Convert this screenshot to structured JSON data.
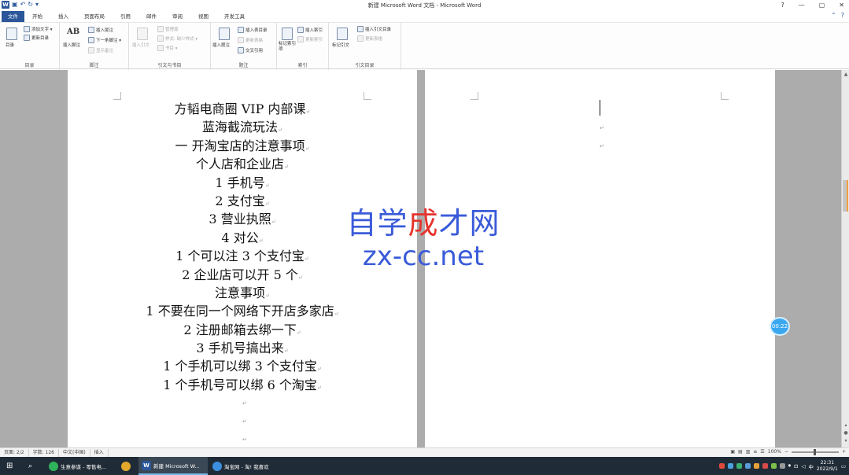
{
  "titlebar": {
    "title": "新建 Microsoft Word 文档 - Microsoft Word",
    "word_logo": "W",
    "controls": [
      "?",
      "—",
      "▢",
      "✕"
    ]
  },
  "tabs": [
    "文件",
    "开始",
    "插入",
    "页面布局",
    "引用",
    "邮件",
    "审阅",
    "视图",
    "开发工具"
  ],
  "ribbon": {
    "toc": {
      "big": "目录",
      "add_text": "添加文字 ▾",
      "update": "更新目录",
      "label": "目录"
    },
    "footnote": {
      "insert_footnote": "插入脚注",
      "insert_endnote": "插入尾注",
      "next_footnote": "下一条脚注 ▾",
      "show_notes": "显示备注",
      "label": "脚注",
      "ab_glyph": "AB"
    },
    "citation": {
      "insert_citation": "插入引文",
      "manage_sources": "管理源",
      "style": "样式: 缺少样式 ▾",
      "bibliography": "书目 ▾",
      "label": "引文与书目"
    },
    "caption": {
      "insert_caption": "插入题注",
      "insert_table_figures": "插入表目录",
      "update_table": "更新表格",
      "cross_ref": "交叉引用",
      "label": "题注"
    },
    "index": {
      "mark_entry": "标记索引项",
      "insert_index": "插入索引",
      "update_index": "更新索引",
      "label": "索引"
    },
    "authorities": {
      "mark_citation": "标记引文",
      "insert_toa": "插入引文目录",
      "update_table": "更新表格",
      "label": "引文目录"
    }
  },
  "document": {
    "lines": [
      "方韬电商圈 VIP 内部课",
      "蓝海截流玩法",
      "一  开淘宝店的注意事项",
      "个人店和企业店",
      "1 手机号",
      "2 支付宝",
      "3 营业执照",
      "4 对公",
      "1 个可以注 3 个支付宝",
      "2 企业店可以开 5 个",
      "注意事项",
      "1 不要在同一个网络下开店多家店",
      "2 注册邮箱去绑一下",
      "3 手机号搞出来",
      "1 个手机可以绑 3 个支付宝",
      "1 个手机号可以绑 6 个淘宝"
    ],
    "para_mark": "↵"
  },
  "watermark": {
    "cn": "自学成才网",
    "en": "zx-cc.net"
  },
  "timer": "00:22",
  "statusbar": {
    "page": "页面: 2/2",
    "words": "字数: 126",
    "lang": "中文(中国)",
    "mode": "插入",
    "zoom": "100%"
  },
  "taskbar": {
    "items": [
      {
        "label": "生意参谋 - 零售电...",
        "color": "#2fb35a"
      },
      {
        "label": "",
        "color": "#e2a82d"
      },
      {
        "label": "新建 Microsoft W...",
        "color": "#2b579a"
      },
      {
        "label": "淘宝网 - 淘! 我喜欢",
        "color": "#3d8fe0"
      }
    ],
    "time": "22:31",
    "date": "2022/9/1",
    "ime": "中"
  }
}
